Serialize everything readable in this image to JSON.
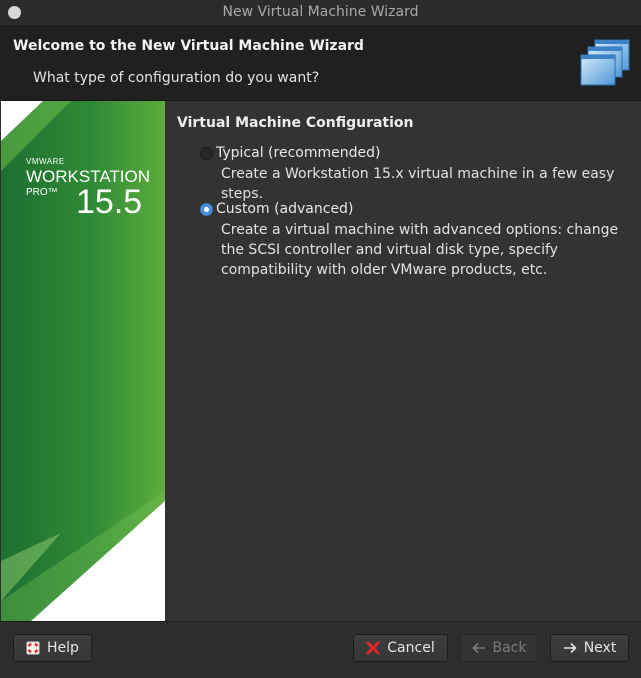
{
  "window": {
    "title": "New Virtual Machine Wizard"
  },
  "header": {
    "title": "Welcome to the New Virtual Machine Wizard",
    "subtitle": "What type of configuration do you want?",
    "icon": "stacked-windows-icon"
  },
  "banner": {
    "brand": "VMWARE",
    "product": "WORKSTATION",
    "edition": "PRO™",
    "version": "15.5",
    "colors": {
      "green_dark": "#1d6e2e",
      "green_light": "#56a83a"
    }
  },
  "config": {
    "section_title": "Virtual Machine Configuration",
    "options": [
      {
        "label": "Typical (recommended)",
        "description": "Create a Workstation 15.x virtual machine in a few easy steps.",
        "selected": false
      },
      {
        "label": "Custom (advanced)",
        "description": "Create a virtual machine with advanced options: change the SCSI controller and virtual disk type, specify compatibility with older VMware products, etc.",
        "selected": true
      }
    ]
  },
  "footer": {
    "help_label": "Help",
    "cancel_label": "Cancel",
    "back_label": "Back",
    "next_label": "Next",
    "back_enabled": false,
    "icons": [
      "lifebuoy-icon",
      "red-x-icon",
      "back-arrow-icon",
      "next-arrow-icon"
    ]
  },
  "colors": {
    "accent": "#4a90d9",
    "cancel_red": "#e0262b"
  }
}
